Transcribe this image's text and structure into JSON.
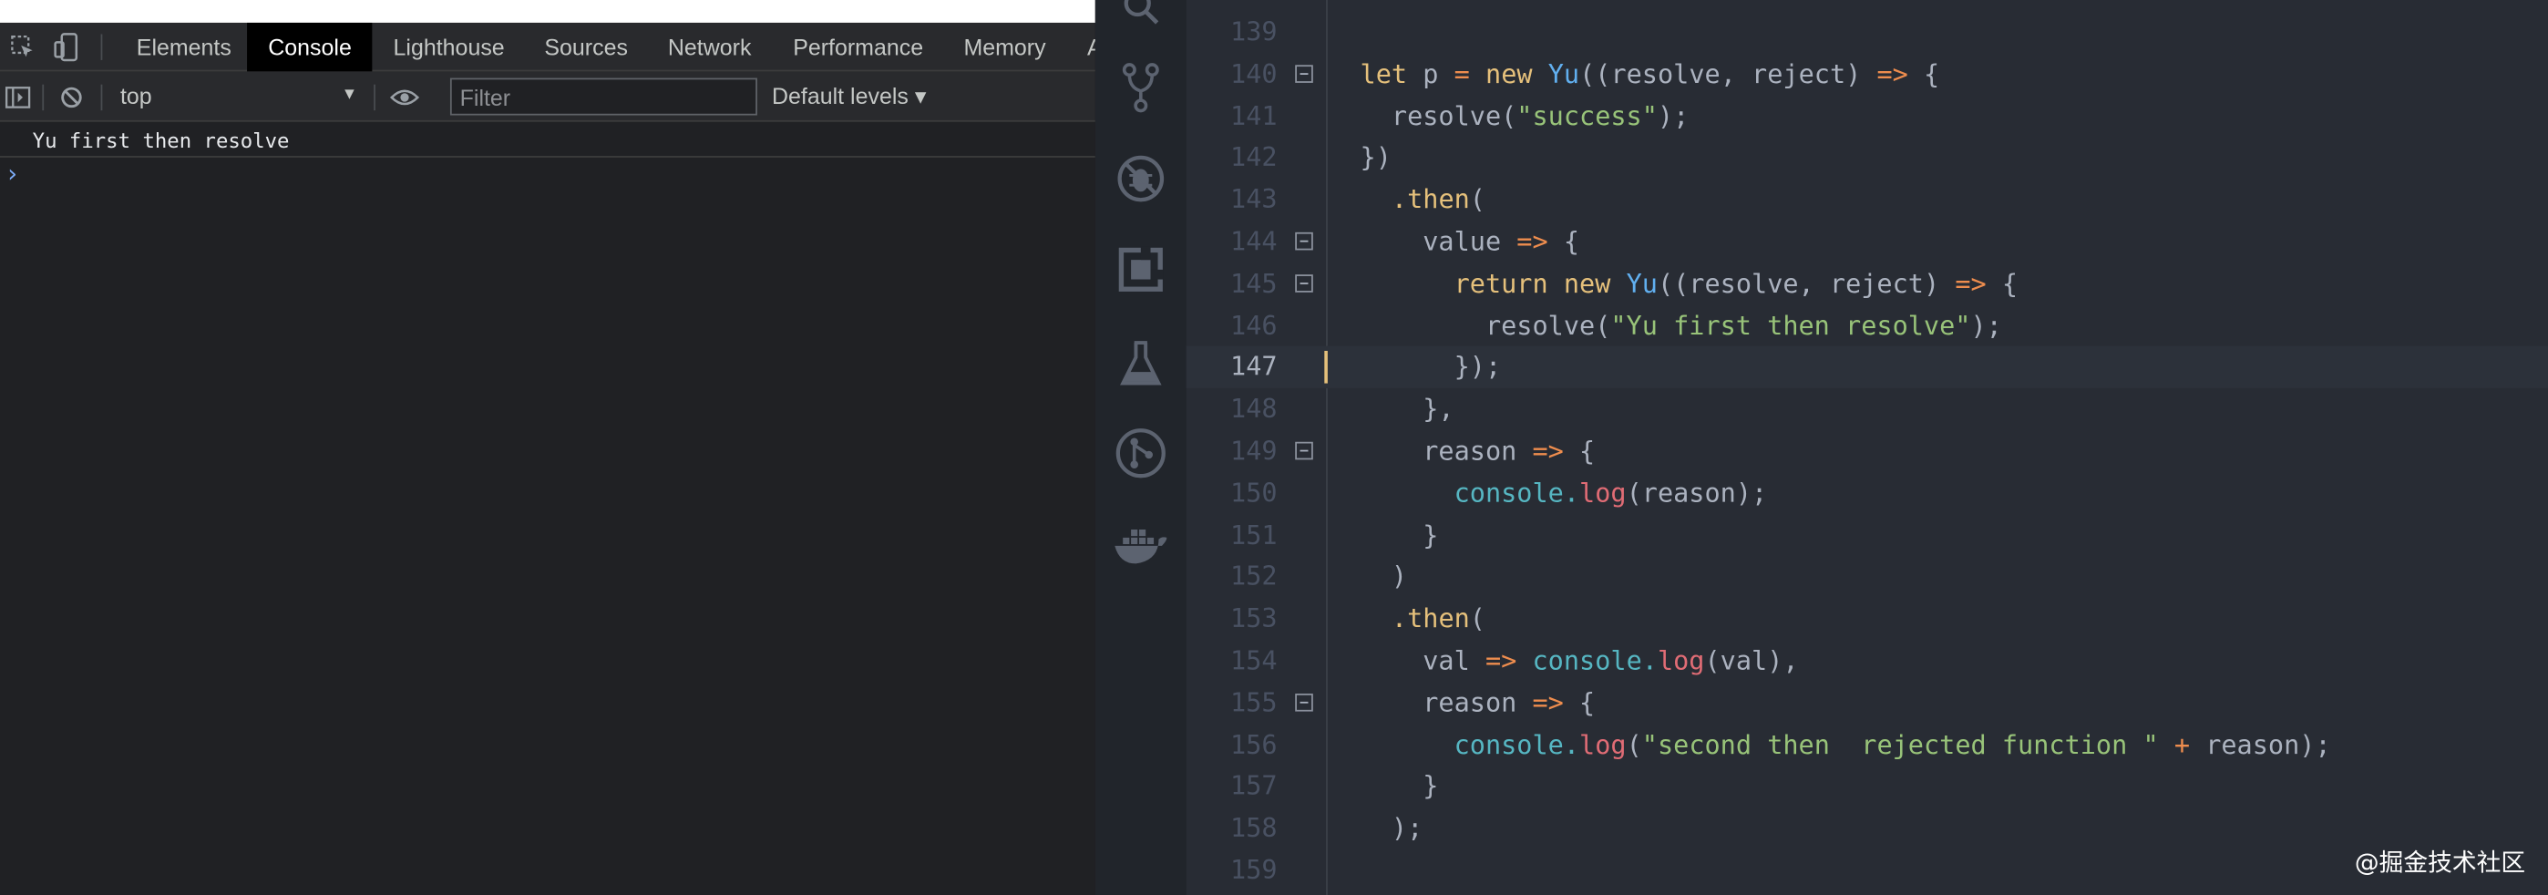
{
  "devtools": {
    "tabs": [
      {
        "label": "Elements",
        "active": false
      },
      {
        "label": "Console",
        "active": true
      },
      {
        "label": "Lighthouse",
        "active": false
      },
      {
        "label": "Sources",
        "active": false
      },
      {
        "label": "Network",
        "active": false
      },
      {
        "label": "Performance",
        "active": false
      },
      {
        "label": "Memory",
        "active": false
      },
      {
        "label": "A",
        "active": false
      }
    ],
    "toolbar": {
      "context": "top",
      "filter_placeholder": "Filter",
      "levels_label": "Default levels ▾"
    },
    "console": {
      "messages": [
        "Yu first then resolve"
      ],
      "prompt": "›"
    }
  },
  "editor": {
    "activity_icons": [
      "search-icon",
      "source-control-icon",
      "debug-icon",
      "extensions-icon",
      "test-flask-icon",
      "git-graph-icon",
      "docker-icon"
    ],
    "current_line": 147,
    "lines": [
      {
        "num": "139",
        "code": ""
      },
      {
        "num": "140",
        "code": "let p = new Yu((resolve, reject) => {"
      },
      {
        "num": "141",
        "code": "  resolve(\"success\");"
      },
      {
        "num": "142",
        "code": "})"
      },
      {
        "num": "143",
        "code": "  .then("
      },
      {
        "num": "144",
        "code": "    value => {"
      },
      {
        "num": "145",
        "code": "      return new Yu((resolve, reject) => {"
      },
      {
        "num": "146",
        "code": "        resolve(\"Yu first then resolve\");"
      },
      {
        "num": "147",
        "code": "      });"
      },
      {
        "num": "148",
        "code": "    },"
      },
      {
        "num": "149",
        "code": "    reason => {"
      },
      {
        "num": "150",
        "code": "      console.log(reason);"
      },
      {
        "num": "151",
        "code": "    }"
      },
      {
        "num": "152",
        "code": "  )"
      },
      {
        "num": "153",
        "code": "  .then("
      },
      {
        "num": "154",
        "code": "    val => console.log(val),"
      },
      {
        "num": "155",
        "code": "    reason => {"
      },
      {
        "num": "156",
        "code": "      console.log(\"second then  rejected function \" + reason);"
      },
      {
        "num": "157",
        "code": "    }"
      },
      {
        "num": "158",
        "code": "  );"
      },
      {
        "num": "159",
        "code": ""
      }
    ],
    "watermark": "@掘金技术社区"
  },
  "colors": {
    "keyword": "#e5c07b",
    "class": "#61afef",
    "string": "#98c379",
    "operator": "#ee8d4e",
    "object": "#56b6c2",
    "method": "#e06c75"
  }
}
